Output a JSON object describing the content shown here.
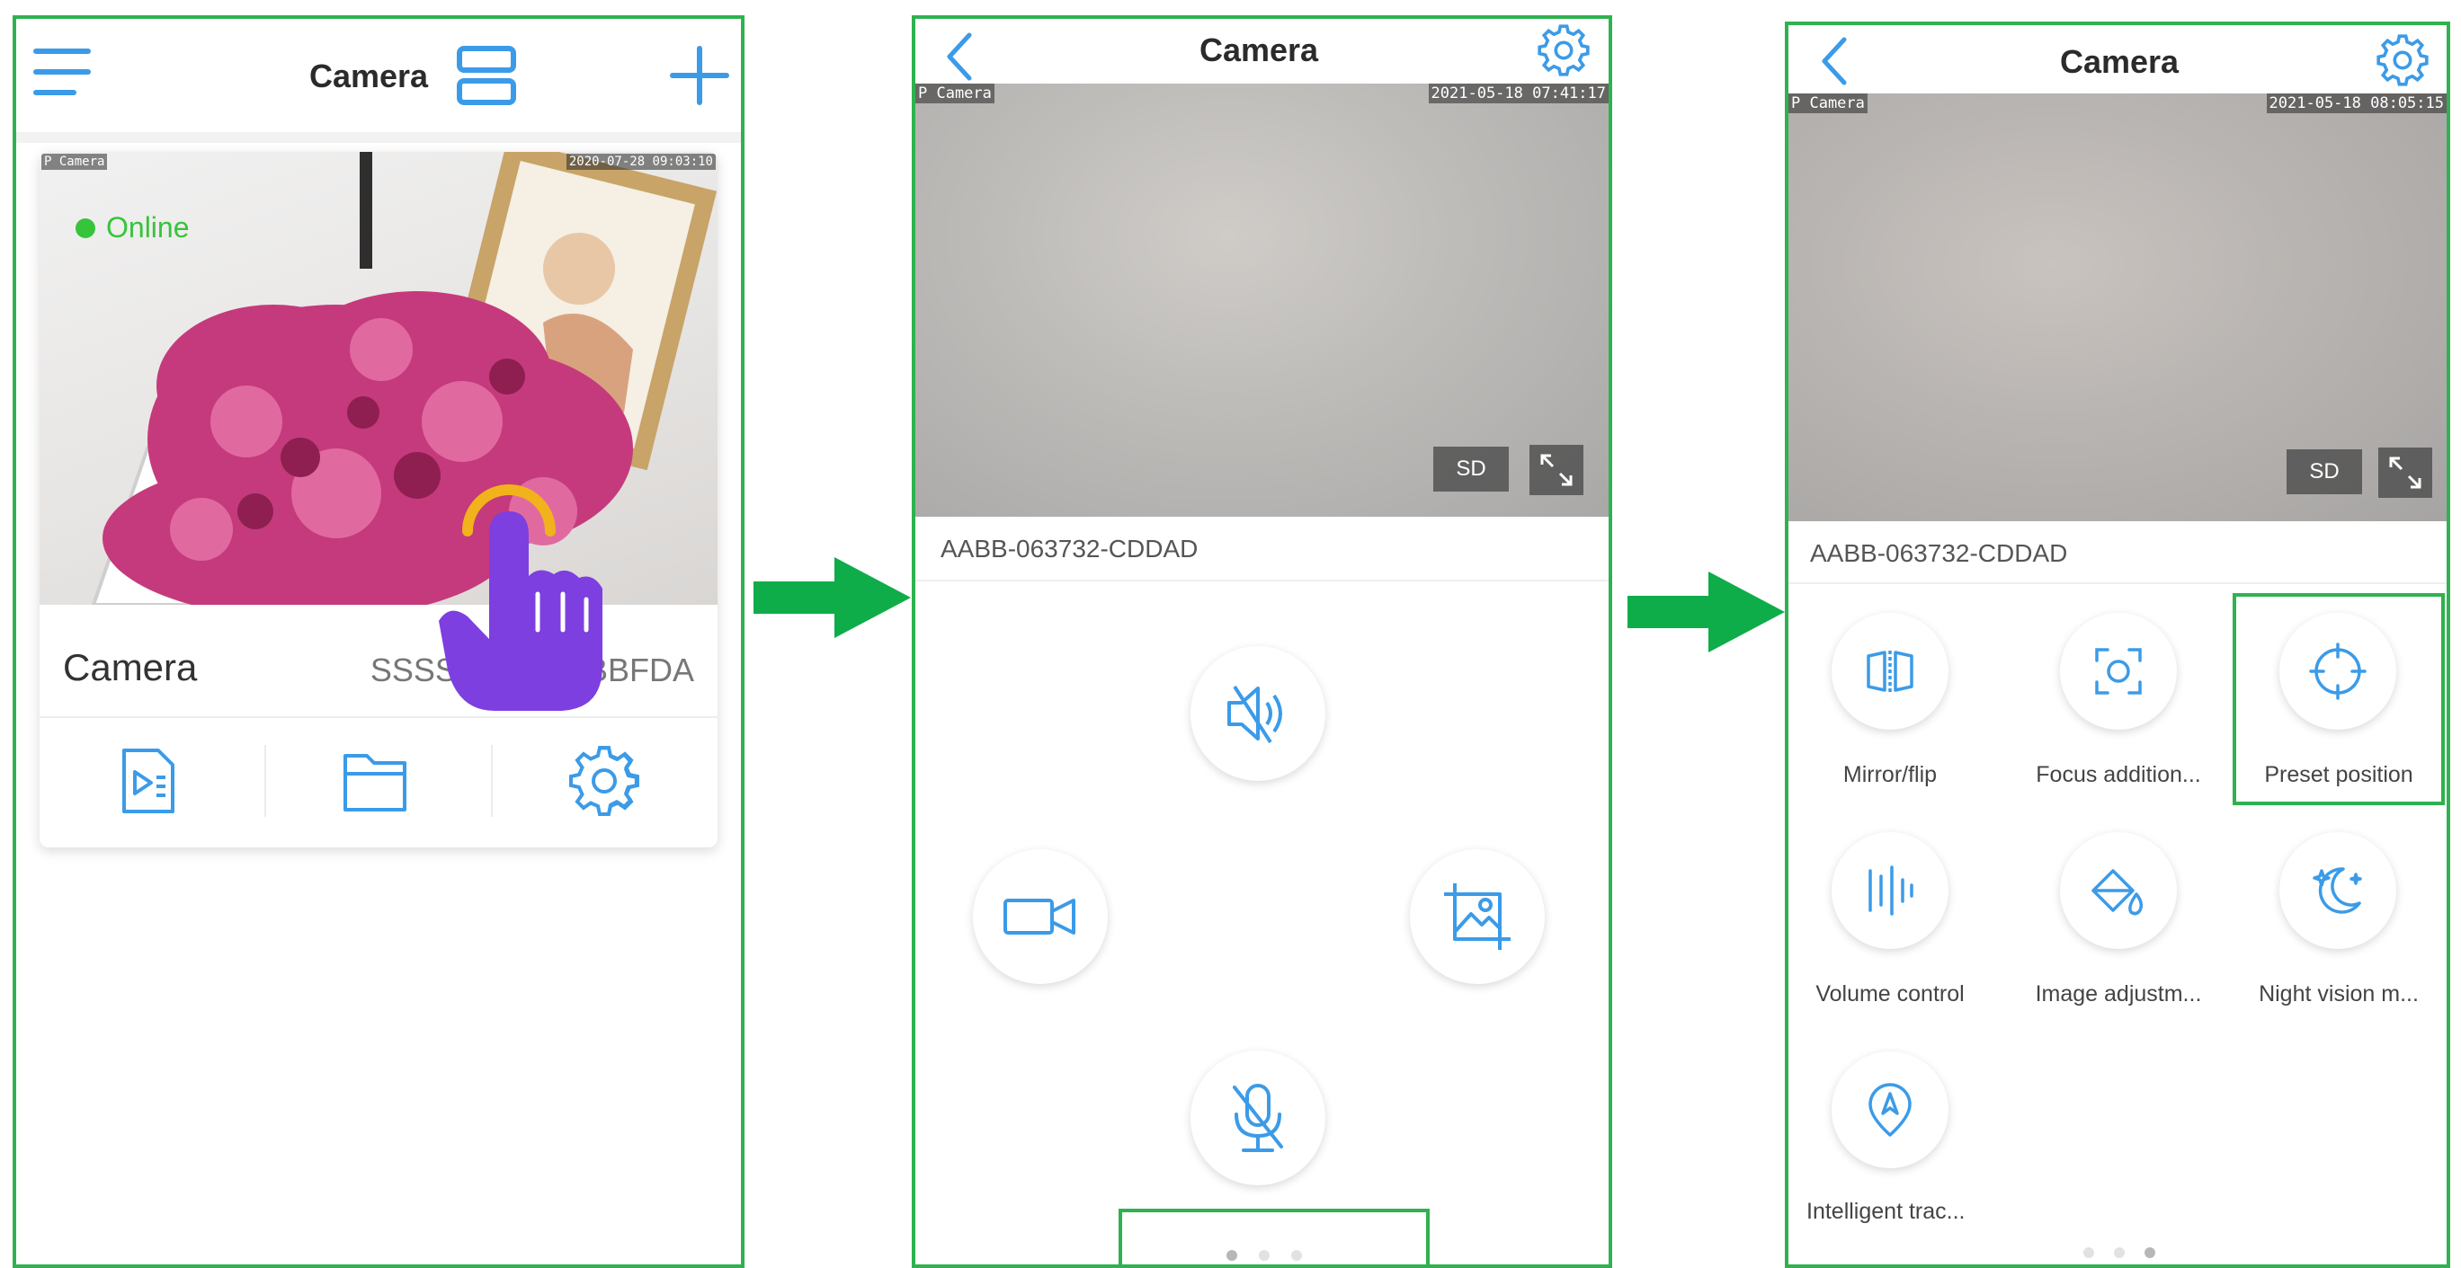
{
  "panel1": {
    "title": "Camera",
    "card": {
      "overlay_name": "P Camera",
      "overlay_time": "2020-07-28 09:03:10",
      "status": "Online",
      "name": "Camera",
      "uid": "SSSS-000000-BBFDA"
    },
    "icons": [
      "menu-icon",
      "layout-toggle-icon",
      "add-icon",
      "playback-file-icon",
      "folder-icon",
      "settings-gear-icon",
      "tap-hand-icon"
    ]
  },
  "panel2": {
    "title": "Camera",
    "overlay_name": "P Camera",
    "overlay_time": "2021-05-18 07:41:17",
    "quality": "SD",
    "device_id": "AABB-063732-CDDAD",
    "icons": [
      "back-icon",
      "settings-gear-icon",
      "fullscreen-icon",
      "speaker-mute-icon",
      "record-video-icon",
      "snapshot-icon",
      "microphone-mute-icon"
    ]
  },
  "panel3": {
    "title": "Camera",
    "overlay_name": "P Camera",
    "overlay_time": "2021-05-18 08:05:15",
    "quality": "SD",
    "device_id": "AABB-063732-CDDAD",
    "functions": [
      {
        "label": "Mirror/flip",
        "icon": "mirror-flip-icon"
      },
      {
        "label": "Focus addition...",
        "icon": "focus-icon"
      },
      {
        "label": "Preset position",
        "icon": "preset-position-icon"
      },
      {
        "label": "Volume control",
        "icon": "volume-control-icon"
      },
      {
        "label": "Image adjustm...",
        "icon": "image-adjust-icon"
      },
      {
        "label": "Night vision m...",
        "icon": "night-vision-icon"
      },
      {
        "label": "Intelligent trac...",
        "icon": "intelligent-tracking-icon"
      }
    ]
  },
  "colors": {
    "accent": "#3b9be8",
    "highlight_border": "#2fb24f",
    "arrow": "#0fac4a",
    "online": "#36c43a",
    "hand": "#7d3fe0"
  }
}
